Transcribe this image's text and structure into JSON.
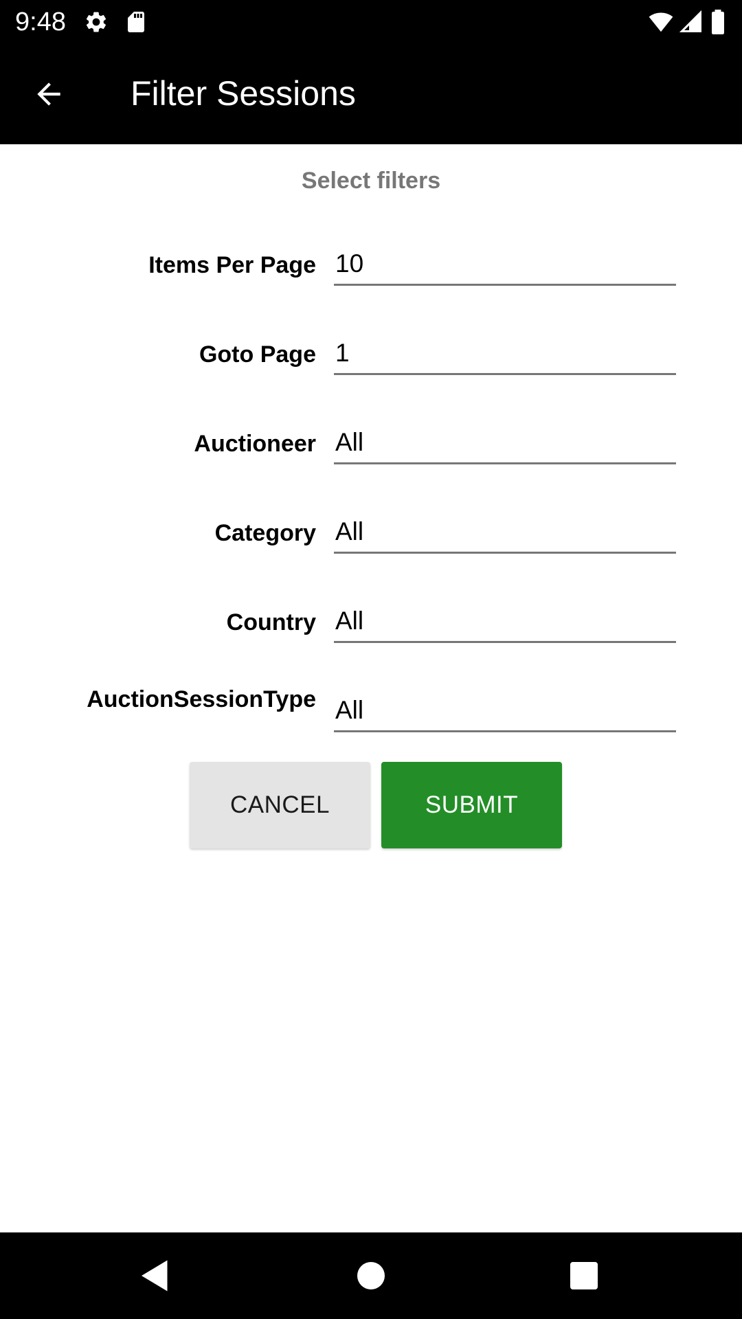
{
  "status_bar": {
    "time": "9:48",
    "icons": [
      "gear-icon",
      "sd-card-icon",
      "wifi-icon",
      "signal-icon",
      "battery-icon"
    ]
  },
  "app_bar": {
    "title": "Filter Sessions",
    "back_icon": "arrow-back-icon"
  },
  "form": {
    "subtitle": "Select filters",
    "fields": [
      {
        "label": "Items Per Page",
        "value": "10"
      },
      {
        "label": "Goto Page",
        "value": "1"
      },
      {
        "label": "Auctioneer",
        "value": "All"
      },
      {
        "label": "Category",
        "value": "All"
      },
      {
        "label": "Country",
        "value": "All"
      },
      {
        "label": "AuctionSessionType",
        "value": "All"
      }
    ],
    "cancel_label": "CANCEL",
    "submit_label": "SUBMIT"
  },
  "nav_bar": {
    "icons": [
      "back-triangle-icon",
      "home-circle-icon",
      "recents-square-icon"
    ]
  },
  "colors": {
    "bar_background": "#000000",
    "submit_green": "#238e27",
    "cancel_gray": "#e4e4e4",
    "subtitle_gray": "#777777"
  }
}
